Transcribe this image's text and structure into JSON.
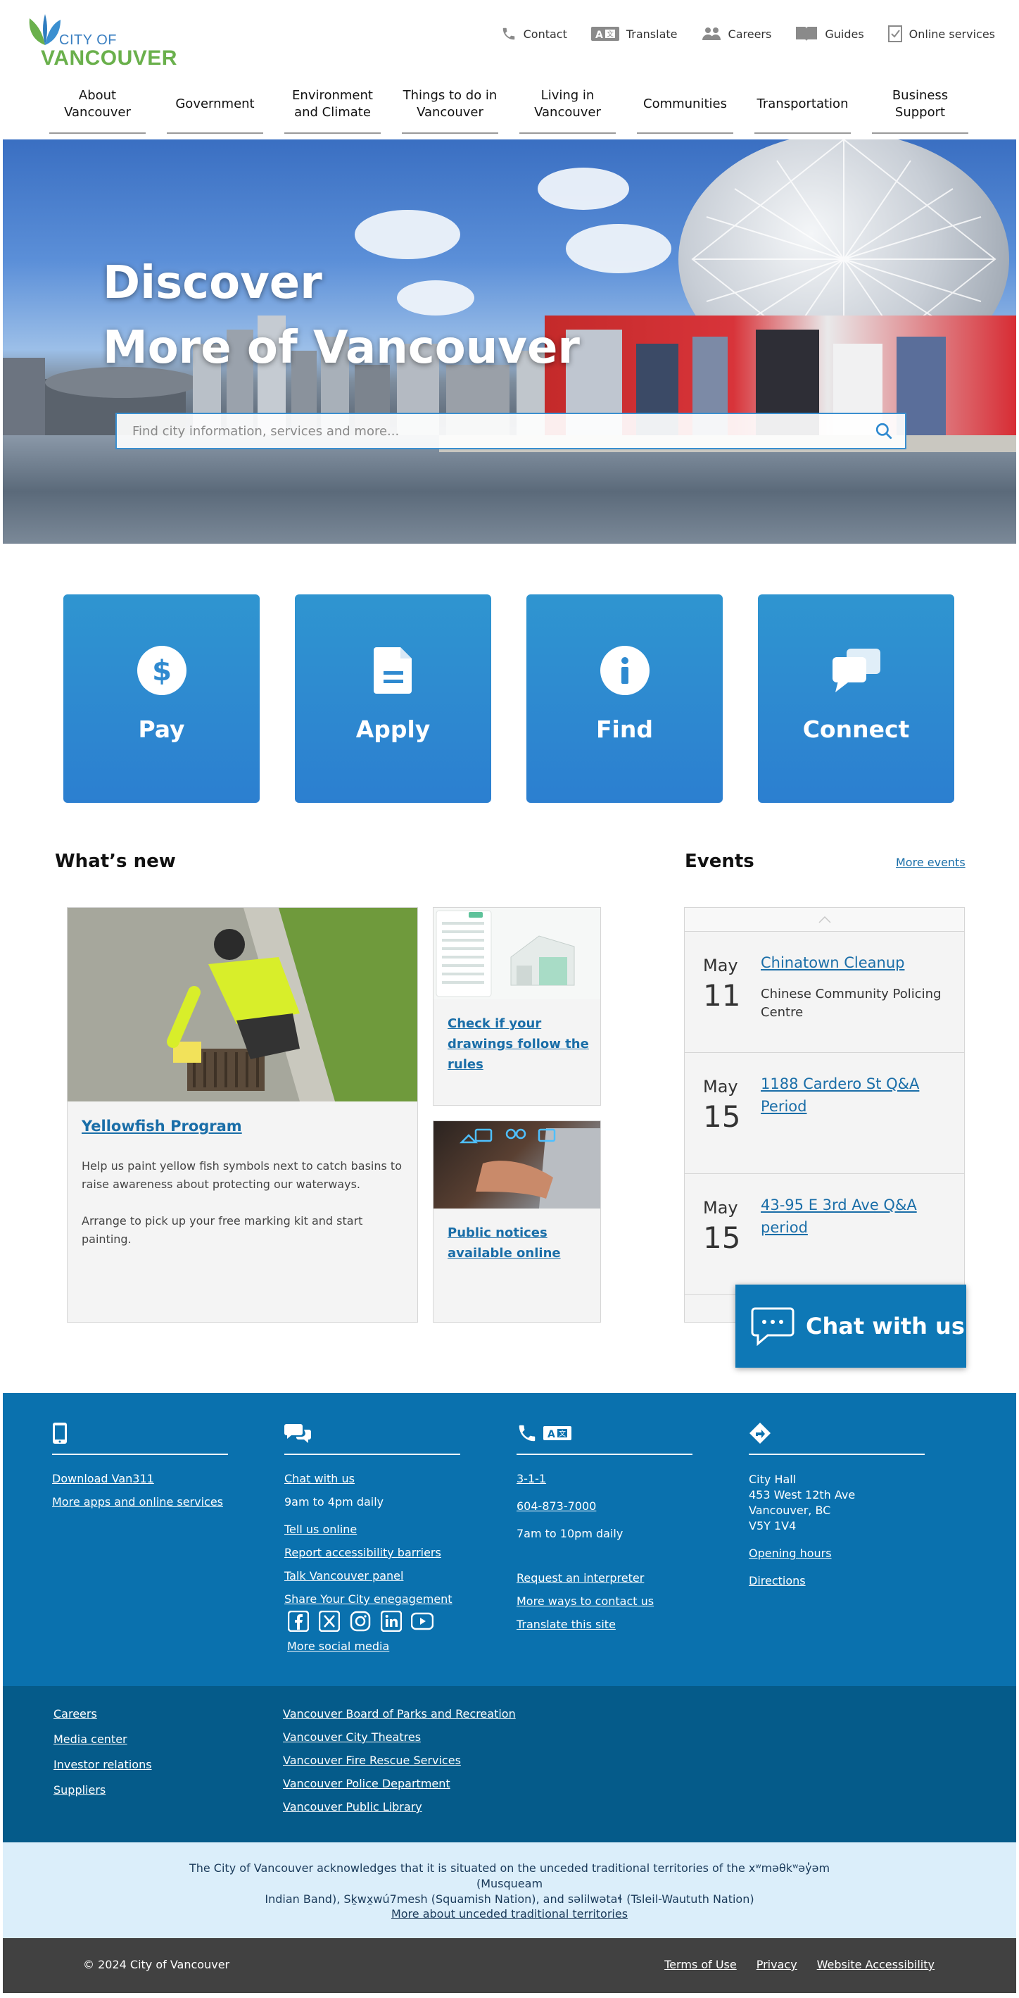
{
  "header": {
    "logo_city": "CITY OF",
    "logo_vancouver": "VANCOUVER",
    "utility": [
      {
        "label": "Contact",
        "icon": "phone-icon"
      },
      {
        "label": "Translate",
        "icon": "translate-icon"
      },
      {
        "label": "Careers",
        "icon": "people-icon"
      },
      {
        "label": "Guides",
        "icon": "book-icon"
      },
      {
        "label": "Online services",
        "icon": "checklist-icon"
      }
    ],
    "nav": [
      {
        "line1": "About",
        "line2": "Vancouver"
      },
      {
        "line1": "Government",
        "line2": ""
      },
      {
        "line1": "Environment",
        "line2": "and Climate"
      },
      {
        "line1": "Things to do in",
        "line2": "Vancouver"
      },
      {
        "line1": "Living in",
        "line2": "Vancouver"
      },
      {
        "line1": "Communities",
        "line2": ""
      },
      {
        "line1": "Transportation",
        "line2": ""
      },
      {
        "line1": "Business",
        "line2": "Support"
      }
    ]
  },
  "hero": {
    "title_line1": "Discover",
    "title_line2": "More of Vancouver",
    "search_placeholder": "Find city information, services and more..."
  },
  "tiles": [
    {
      "label": "Pay",
      "icon": "dollar-icon"
    },
    {
      "label": "Apply",
      "icon": "document-icon"
    },
    {
      "label": "Find",
      "icon": "info-icon"
    },
    {
      "label": "Connect",
      "icon": "chat-bubbles-icon"
    }
  ],
  "whats_new": {
    "heading": "What’s new",
    "main": {
      "title": "Yellowfish Program",
      "desc1": "Help us paint yellow fish symbols next to catch basins to raise awareness about protecting our waterways.",
      "desc2": "Arrange to pick up your free marking kit and start painting."
    },
    "item2": {
      "line1": "Check if your",
      "line2": "drawings follow the",
      "line3": "rules"
    },
    "item3": {
      "line1": "Public notices",
      "line2": "available online"
    }
  },
  "events": {
    "heading": "Events",
    "more": "More events",
    "items": [
      {
        "month": "May",
        "day": "11",
        "title": "Chinatown Cleanup",
        "location": "Chinese Community Policing Centre"
      },
      {
        "month": "May",
        "day": "15",
        "title": "1188 Cardero St Q&A Period",
        "location": ""
      },
      {
        "month": "May",
        "day": "15",
        "title": "43-95 E 3rd Ave Q&A period",
        "location": ""
      }
    ]
  },
  "chat": {
    "label": "Chat with us"
  },
  "footer": {
    "col1": {
      "links": [
        "Download Van311",
        "More apps and online services"
      ]
    },
    "col2": {
      "chat": "Chat with us",
      "hours": "9am to 4pm daily",
      "links": [
        "Tell us online",
        "Report accessibility barriers",
        "Talk Vancouver panel",
        "Share Your City enegagement"
      ],
      "social_more": "More social media"
    },
    "col3": {
      "phone311": "3-1-1",
      "phone": "604-873-7000",
      "hours": "7am to 10pm daily",
      "links": [
        "Request an interpreter",
        "More ways to contact us",
        "Translate this site"
      ]
    },
    "col4": {
      "addr1": "City Hall",
      "addr2": "453 West 12th Ave",
      "addr3": "Vancouver, BC",
      "addr4": "V5Y 1V4",
      "links": [
        "Opening hours",
        "Directions"
      ]
    },
    "lower_left": [
      "Careers",
      "Media center",
      "Investor relations",
      "Suppliers"
    ],
    "lower_right": [
      "Vancouver Board of Parks and Recreation",
      "Vancouver City Theatres",
      "Vancouver Fire Rescue Services",
      "Vancouver Police Department",
      "Vancouver Public Library"
    ],
    "ack_line1": "The City of Vancouver acknowledges that it is situated on the unceded traditional territories of the xʷməθkʷəy̓əm (Musqueam",
    "ack_line2": "Indian Band), Sḵwx̱wú7mesh (Squamish Nation), and səlilwətaɬ (Tsleil-Waututh Nation)",
    "ack_link": "More about unceded traditional territories",
    "copyright": "© 2024 City of Vancouver",
    "legal": [
      "Terms of Use",
      "Privacy",
      "Website Accessibility"
    ]
  },
  "colors": {
    "brand_blue": "#0a71ae",
    "tile_blue": "#2f8ad0",
    "dark_blue": "#055b8a",
    "link": "#1a6ea8",
    "logo_green": "#6ab04c"
  }
}
